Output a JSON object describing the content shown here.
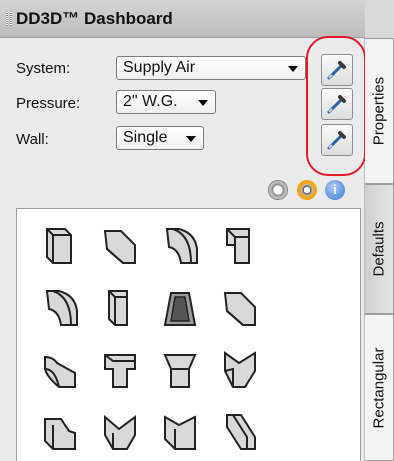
{
  "title": "DD3D™ Dashboard",
  "fields": {
    "system": {
      "label": "System:",
      "value": "Supply Air"
    },
    "pressure": {
      "label": "Pressure:",
      "value": "2\" W.G."
    },
    "wall": {
      "label": "Wall:",
      "value": "Single"
    }
  },
  "pick_buttons": [
    "eyedropper-icon",
    "eyedropper-icon",
    "eyedropper-icon"
  ],
  "view_icons": [
    "disc-icon",
    "ring-icon",
    "info-icon"
  ],
  "fittings": [
    [
      "straight",
      "elbow-45",
      "elbow-radius",
      "elbow-90"
    ],
    [
      "elbow-radius",
      "offset",
      "hood",
      "elbow-45"
    ],
    [
      "tee-radius",
      "tee",
      "tee-square",
      "wye"
    ],
    [
      "tee-notch",
      "wye-split",
      "tee-angled",
      "offset-long"
    ]
  ],
  "tabs": [
    "Properties",
    "Defaults",
    "Rectangular"
  ],
  "colors": {
    "highlight": "#e21b2a",
    "accent": "#f3a61a",
    "info": "#3a7bd5"
  }
}
